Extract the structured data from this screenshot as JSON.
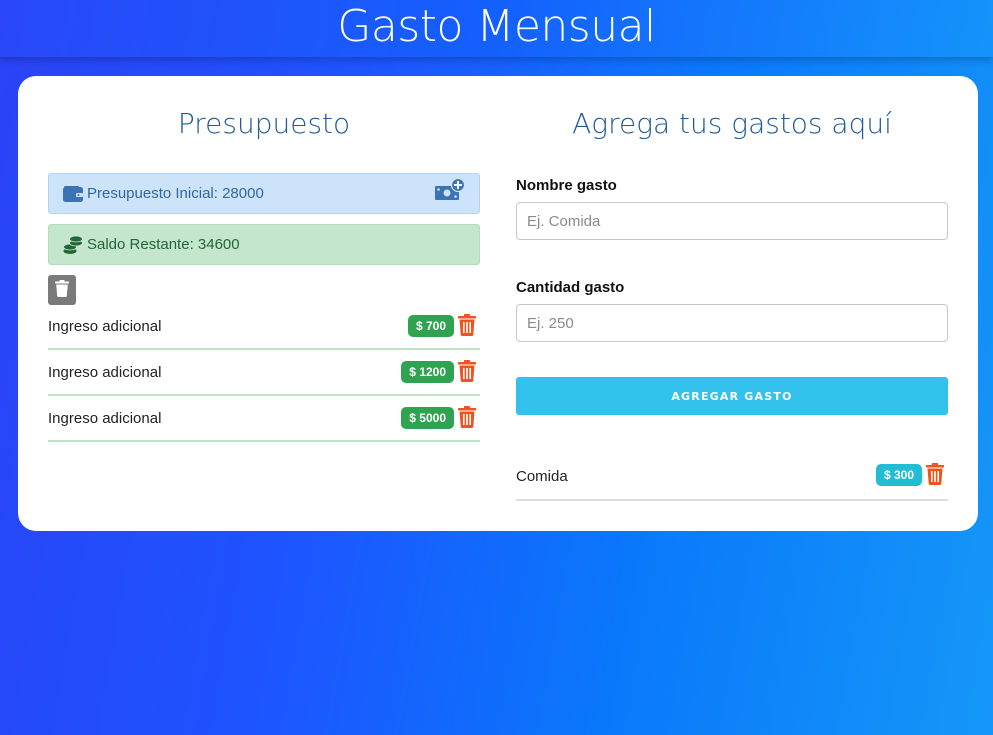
{
  "header": {
    "title": "Gasto Mensual"
  },
  "budget": {
    "title": "Presupuesto",
    "initial": "Presupuesto Inicial: 28000",
    "remaining": "Saldo Restante: 34600",
    "incomes": [
      {
        "name": "Ingreso adicional",
        "amount": "$ 700"
      },
      {
        "name": "Ingreso adicional",
        "amount": "$ 1200"
      },
      {
        "name": "Ingreso adicional",
        "amount": "$ 5000"
      }
    ]
  },
  "expenses": {
    "title": "Agrega tus gastos aquí",
    "name_label": "Nombre gasto",
    "name_placeholder": "Ej. Comida",
    "qty_label": "Cantidad gasto",
    "qty_placeholder": "Ej. 250",
    "submit_label": "AGREGAR GASTO",
    "items": [
      {
        "name": "Comida",
        "amount": "$ 300"
      }
    ]
  },
  "icons": {
    "wallet": "wallet-icon",
    "coins": "coins-icon",
    "add_money": "money-plus-icon",
    "trash": "trash-icon"
  },
  "colors": {
    "trash_red": "#f0541e",
    "income_green": "#2fa34f",
    "expense_cyan": "#22bcd4",
    "title_blue": "#1f5a96"
  }
}
